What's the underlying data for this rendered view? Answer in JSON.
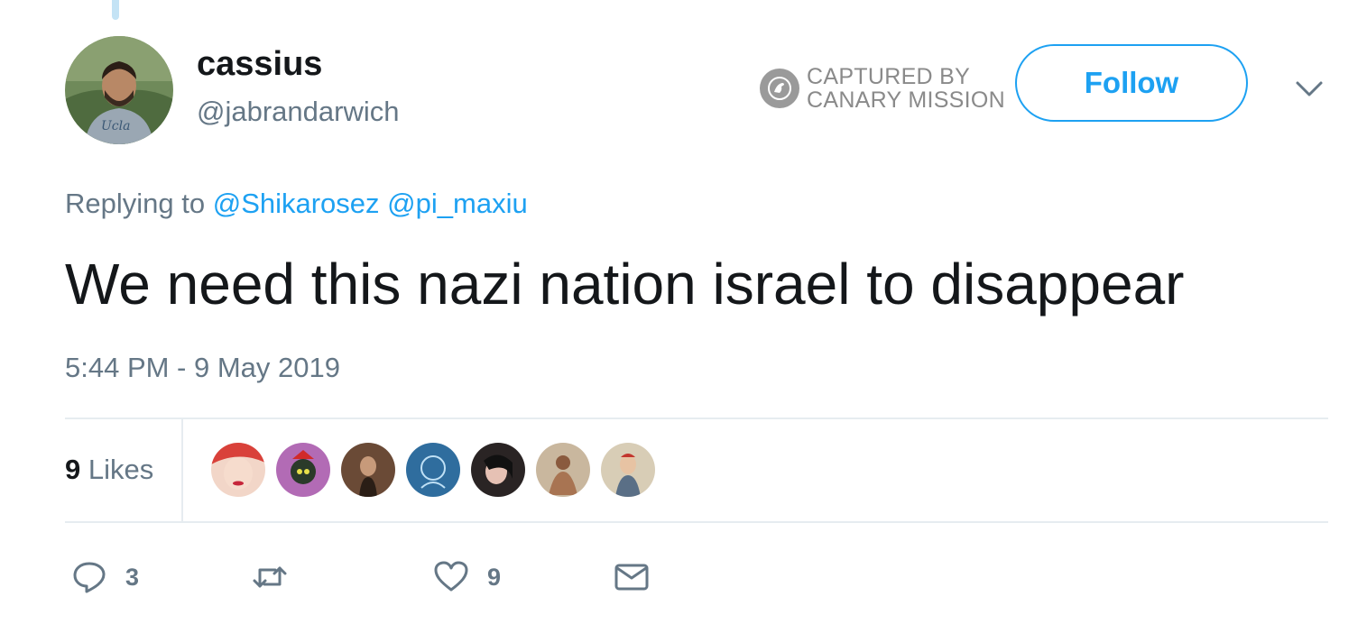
{
  "user": {
    "display_name": "cassius",
    "handle": "@jabrandarwich"
  },
  "watermark": {
    "line1": "CAPTURED BY",
    "line2": "CANARY MISSION"
  },
  "follow_label": "Follow",
  "reply_context": {
    "prefix": "Replying to",
    "mentions": [
      "@Shikarosez",
      "@pi_maxiu"
    ]
  },
  "tweet": {
    "text": "We need this nazi nation israel to disappear",
    "timestamp": "5:44 PM - 9 May 2019"
  },
  "stats": {
    "likes_count": "9",
    "likes_label": "Likes"
  },
  "actions": {
    "replies": "3",
    "likes": "9"
  },
  "colors": {
    "accent": "#1da1f2",
    "secondary_text": "#657786",
    "divider": "#e6ecf0"
  }
}
